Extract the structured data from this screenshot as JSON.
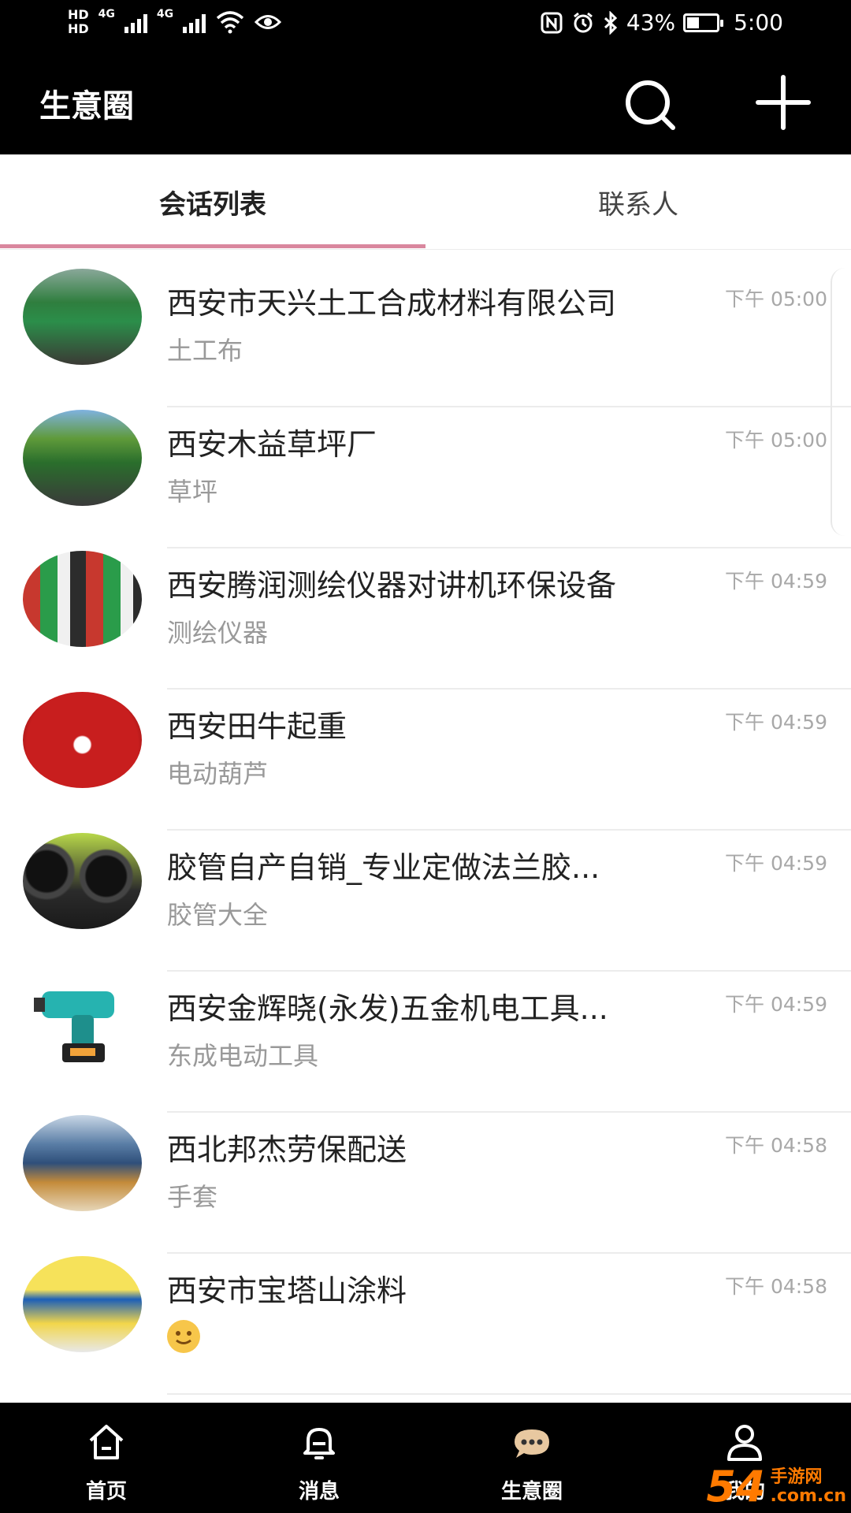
{
  "status_bar": {
    "hd_top": "HD",
    "hd_bottom": "HD",
    "sig1": "4G",
    "sig2": "4G",
    "battery_percent": "43%",
    "battery_level": 0.43,
    "time": "5:00",
    "icons": [
      "nfc-icon",
      "alarm-icon",
      "bluetooth-icon",
      "wifi-icon",
      "battery-icon"
    ]
  },
  "header": {
    "title": "生意圈",
    "icons": [
      "search-icon",
      "add-icon"
    ]
  },
  "tabs": {
    "active_label": "会话列表",
    "inactive_label": "联系人"
  },
  "conversations": [
    {
      "title": "西安市天兴土工合成材料有限公司",
      "subtitle": "土工布",
      "time": "下午 05:00"
    },
    {
      "title": "西安木益草坪厂",
      "subtitle": "草坪",
      "time": "下午 05:00"
    },
    {
      "title": "西安腾润测绘仪器对讲机环保设备",
      "subtitle": "测绘仪器",
      "time": "下午 04:59"
    },
    {
      "title": "西安田牛起重",
      "subtitle": "电动葫芦",
      "time": "下午 04:59"
    },
    {
      "title": "胶管自产自销_专业定做法兰胶...",
      "subtitle": "胶管大全",
      "time": "下午 04:59"
    },
    {
      "title": "西安金辉晓(永发)五金机电工具...",
      "subtitle": "东成电动工具",
      "time": "下午 04:59"
    },
    {
      "title": "西北邦杰劳保配送",
      "subtitle": "手套",
      "time": "下午 04:58"
    },
    {
      "title": "西安市宝塔山涂料",
      "subtitle": "",
      "time": "下午 04:58"
    }
  ],
  "bottom_nav": {
    "items": [
      {
        "label": "首页",
        "icon": "home-icon"
      },
      {
        "label": "消息",
        "icon": "bell-icon"
      },
      {
        "label": "生意圈",
        "icon": "chat-bubble-icon"
      },
      {
        "label": "我的",
        "icon": "user-icon"
      }
    ]
  },
  "watermark": {
    "number": "54",
    "text_top": "手游网",
    "text_bottom": ".com.cn"
  },
  "colors": {
    "bar_background": "#000000",
    "tab_indicator": "#d9879e",
    "active_nav_icon": "#e8c8a0",
    "muted_text": "#999999",
    "watermark": "#ff7a00"
  }
}
